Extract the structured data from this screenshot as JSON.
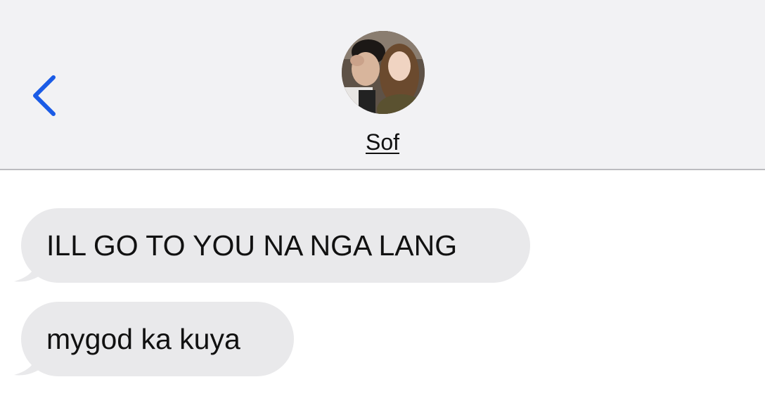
{
  "header": {
    "back_icon": "chevron-left-icon",
    "contact_name": "Sof",
    "avatar_icon": "contact-photo",
    "accent_color": "#1a5be6"
  },
  "messages": [
    {
      "direction": "incoming",
      "text": "ILL GO TO YOU NA NGA LANG"
    },
    {
      "direction": "incoming",
      "text": "mygod ka kuya"
    }
  ],
  "colors": {
    "header_bg": "#f2f2f4",
    "incoming_bubble": "#e9e9eb",
    "divider": "#bcbcc0"
  }
}
